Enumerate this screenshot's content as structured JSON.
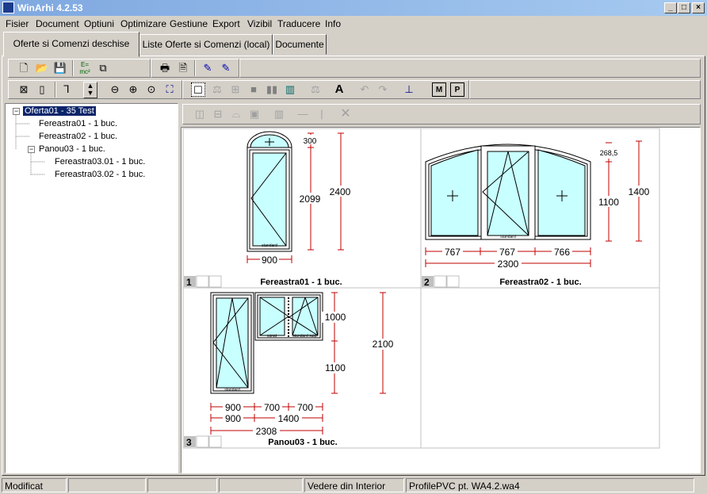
{
  "window": {
    "title": "WinArhi 4.2.53",
    "buttons": [
      "_",
      "□",
      "×"
    ]
  },
  "menu": [
    "Fisier",
    "Document",
    "Optiuni",
    "Optimizare",
    "Gestiune",
    "Export",
    "Vizibil",
    "Traducere",
    "Info"
  ],
  "tabs": [
    {
      "label": "Oferte si Comenzi deschise",
      "active": true
    },
    {
      "label": "Liste Oferte si Comenzi  (local)"
    },
    {
      "label": "Documente"
    }
  ],
  "toolbar": {
    "row1": [
      "new-icon",
      "open-icon",
      "save-icon",
      "formula-icon",
      "copy-icon",
      "print-icon",
      "print-preview-icon",
      "edit-icon",
      "edit2-icon"
    ],
    "row2": [
      "select-icon",
      "frame-icon",
      "profile-icon",
      "updown-icon",
      "zoom-out-icon",
      "zoom-in-icon",
      "zoom-window-icon",
      "zoom-fit-icon",
      "single-view-icon",
      "scale-icon",
      "grid-icon",
      "fill-icon",
      "split-icon",
      "glass-icon",
      "balance-icon",
      "text-icon",
      "undo-icon",
      "redo-icon",
      "dimension-icon",
      "m-icon",
      "p-icon"
    ]
  },
  "tree": {
    "root": "Oferta01 - 35 Test",
    "children": [
      "Fereastra01 - 1 buc.",
      "Fereastra02 - 1 buc.",
      "Panou03 - 1 buc."
    ],
    "sub": [
      "Fereastra03.01 - 1 buc.",
      "Fereastra03.02 - 1 buc."
    ]
  },
  "cells": [
    {
      "num": "1",
      "title": "Fereastra01 - 1 buc.",
      "dims": {
        "w": "900",
        "h_top": "300",
        "h_main": "2099",
        "h_total": "2400"
      },
      "label": "standard"
    },
    {
      "num": "2",
      "title": "Fereastra02 - 1 buc.",
      "dims": {
        "w1": "767",
        "w2": "767",
        "w3": "766",
        "w_total": "2300",
        "h_arch": "268,5",
        "h_main": "1100",
        "h_total": "1400"
      },
      "label": "standard"
    },
    {
      "num": "3",
      "title": "Panou03 - 1 buc.",
      "dims": {
        "a1": "900",
        "a2": "700",
        "a3": "700",
        "b1": "900",
        "b2": "1400",
        "w_total": "2308",
        "h_top": "1000",
        "h_bottom": "1100",
        "h_total": "2100"
      },
      "labels": [
        "standard",
        "canat",
        "standard sulp."
      ]
    }
  ],
  "status": [
    "Modificat",
    "",
    "",
    "",
    "Vedere din Interior",
    "ProfilePVC pt. WA4.2.wa4"
  ],
  "colors": {
    "glass": "#c8ffff",
    "dimension": "#c00000",
    "selection": "#0a246a"
  }
}
